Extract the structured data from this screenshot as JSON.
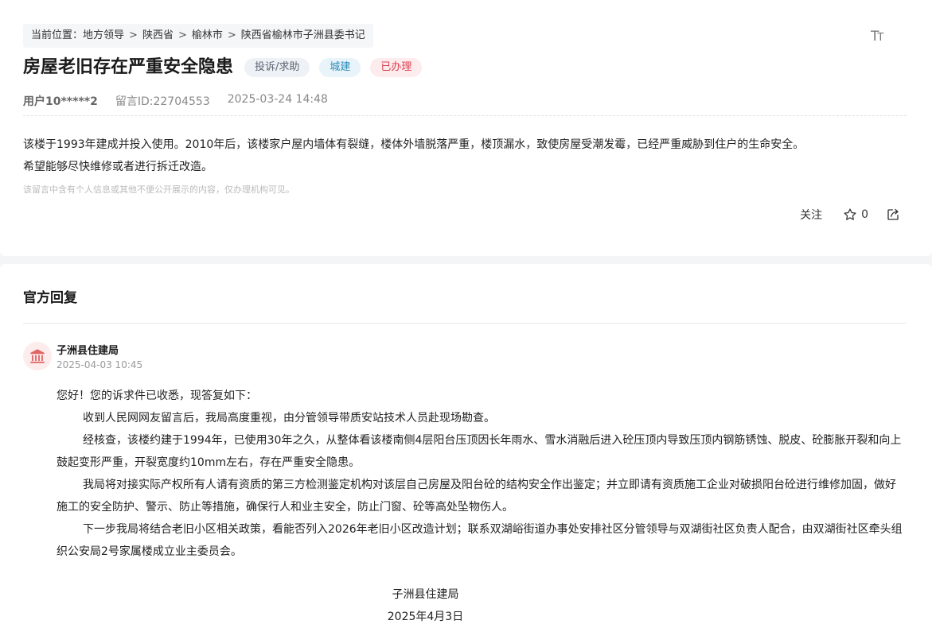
{
  "breadcrumb": {
    "prefix": "当前位置：",
    "items": [
      "地方领导",
      "陕西省",
      "榆林市",
      "陕西省榆林市子洲县委书记"
    ],
    "sep": ">"
  },
  "font_toggle": {
    "big": "T",
    "small": "T"
  },
  "post": {
    "title": "房屋老旧存在严重安全隐患",
    "tags": [
      "投诉/求助",
      "城建",
      "已办理"
    ],
    "user": "用户10*****2",
    "message_id": "留言ID:22704553",
    "datetime": "2025-03-24 14:48",
    "content": [
      "该楼于1993年建成并投入使用。2010年后，该楼家户屋内墙体有裂缝，楼体外墙脱落严重，楼顶漏水，致使房屋受潮发霉，已经严重威胁到住户的生命安全。",
      "希望能够尽快维修或者进行拆迁改造。"
    ],
    "privacy_note": "该留言中含有个人信息或其他不便公开展示的内容，仅办理机构可见。"
  },
  "actions": {
    "follow": "关注",
    "star_count": "0"
  },
  "reply": {
    "section_title": "官方回复",
    "org_name": "子洲县住建局",
    "time": "2025-04-03 10:45",
    "greeting": "您好！您的诉求件已收悉，现答复如下：",
    "paragraphs": [
      "收到人民网网友留言后，我局高度重视，由分管领导带质安站技术人员赴现场勘查。",
      "经核查，该楼约建于1994年，已使用30年之久，从整体看该楼南侧4层阳台压顶因长年雨水、雪水消融后进入砼压顶内导致压顶内钢筋锈蚀、脱皮、砼膨胀开裂和向上鼓起变形严重，开裂宽度约10mm左右，存在严重安全隐患。",
      "我局将对接实际产权所有人请有资质的第三方检测鉴定机构对该层自己房屋及阳台砼的结构安全作出鉴定；并立即请有资质施工企业对破损阳台砼进行维修加固，做好施工的安全防护、警示、防止等措施，确保行人和业主安全，防止门窗、砼等高处坠物伤人。",
      "下一步我局将结合老旧小区相关政策，看能否列入2026年老旧小区改造计划；联系双湖峪街道办事处安排社区分管领导与双湖街社区负责人配合，由双湖街社区牵头组织公安局2号家属楼成立业主委员会。"
    ],
    "signature": "子洲县住建局",
    "sign_date": "2025年4月3日"
  },
  "colors": {
    "tag_gray": "#5a6472",
    "tag_blue": "#2a8bb8",
    "tag_red": "#d8414f",
    "avatar_icon": "#e06565"
  },
  "icons": [
    "font-size-icon",
    "star-icon",
    "share-icon",
    "government-building-icon"
  ]
}
